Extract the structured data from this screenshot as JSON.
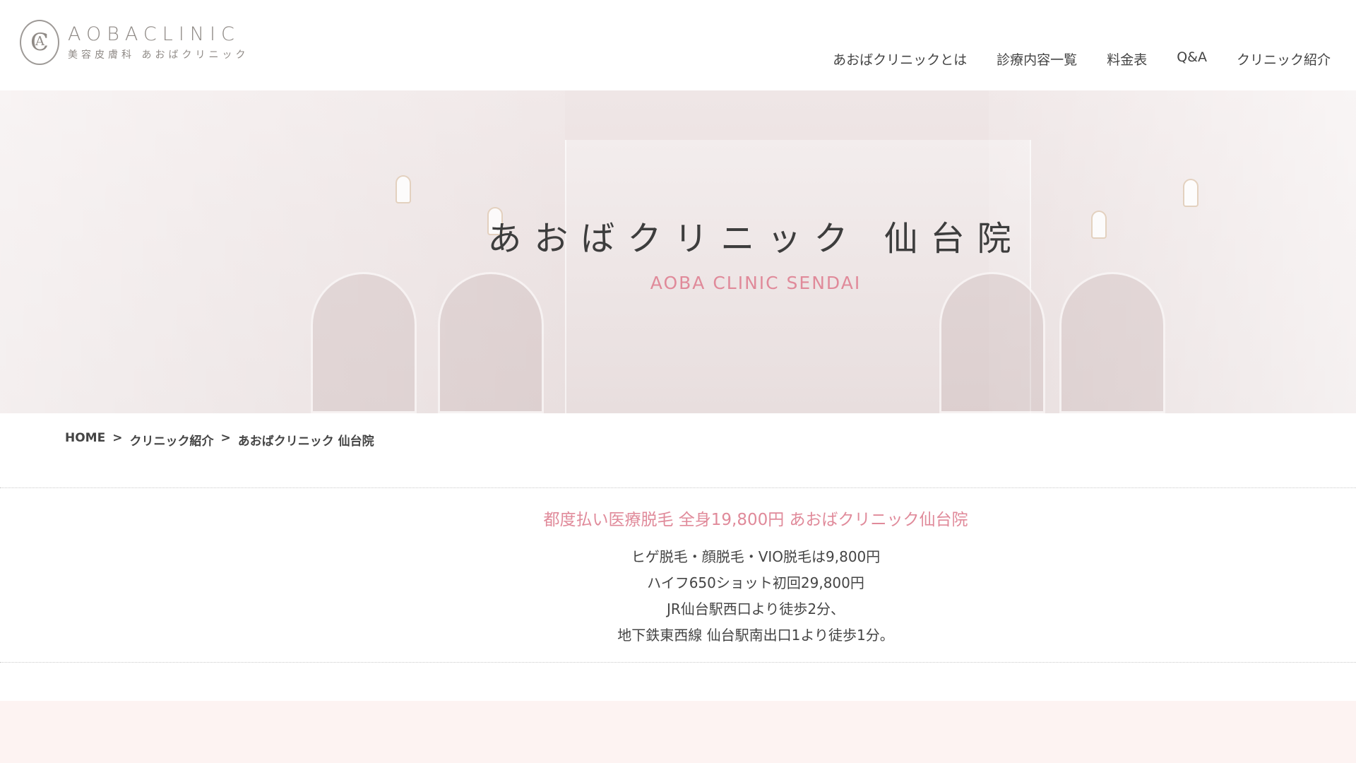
{
  "logo": {
    "name": "AOBACLINIC",
    "subtitle": "美容皮膚科 あおばクリニック"
  },
  "nav": {
    "items": [
      {
        "label": "あおばクリニックとは"
      },
      {
        "label": "診療内容一覧"
      },
      {
        "label": "料金表"
      },
      {
        "label": "Q&A"
      },
      {
        "label": "クリニック紹介"
      }
    ]
  },
  "hero": {
    "title": "あおばクリニック 仙台院",
    "subtitle": "AOBA CLINIC SENDAI"
  },
  "breadcrumb": {
    "home": "HOME",
    "separator": ">",
    "level1": "クリニック紹介",
    "current": "あおばクリニック 仙台院"
  },
  "intro": {
    "heading": "都度払い医療脱毛 全身19,800円 あおばクリニック仙台院",
    "lines": [
      "ヒゲ脱毛・顔脱毛・VIO脱毛は9,800円",
      "ハイフ650ショット初回29,800円",
      "JR仙台駅西口より徒歩2分、",
      "地下鉄東西線 仙台駅南出口1より徒歩1分。"
    ]
  },
  "colors": {
    "accent": "#e08a9a",
    "hero_bg": "#ebe1e1",
    "band_bg": "#fdf3f2"
  }
}
